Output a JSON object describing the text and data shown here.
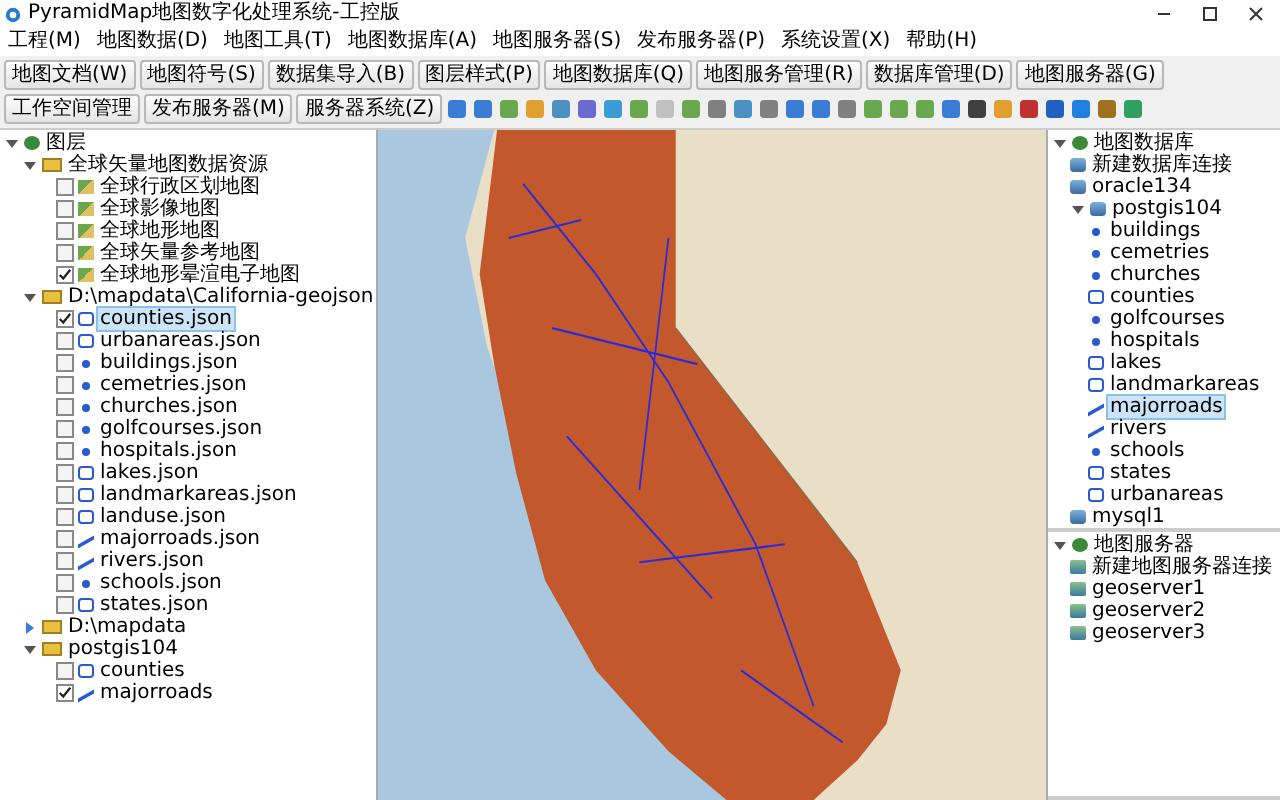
{
  "window": {
    "title": "PyramidMap地图数字化处理系统-工控版"
  },
  "menu": [
    "工程(M)",
    "地图数据(D)",
    "地图工具(T)",
    "地图数据库(A)",
    "地图服务器(S)",
    "发布服务器(P)",
    "系统设置(X)",
    "帮助(H)"
  ],
  "toolbar": [
    "地图文档(W)",
    "地图符号(S)",
    "数据集导入(B)",
    "图层样式(P)",
    "地图数据库(Q)",
    "地图服务管理(R)",
    "数据库管理(D)",
    "地图服务器(G)",
    "工作空间管理",
    "发布服务器(M)",
    "服务器系统(Z)"
  ],
  "layers": {
    "label": "图层",
    "kind": "root",
    "expanded": true,
    "children": [
      {
        "label": "全球矢量地图数据资源",
        "kind": "folder",
        "expanded": true,
        "children": [
          {
            "label": "全球行政区划地图",
            "kind": "raster",
            "checked": false,
            "selected": false
          },
          {
            "label": "全球影像地图",
            "kind": "raster",
            "checked": false,
            "selected": false
          },
          {
            "label": "全球地形地图",
            "kind": "raster",
            "checked": false,
            "selected": false
          },
          {
            "label": "全球矢量参考地图",
            "kind": "raster",
            "checked": false,
            "selected": false
          },
          {
            "label": "全球地形晕渲电子地图",
            "kind": "raster",
            "checked": true,
            "selected": false
          }
        ]
      },
      {
        "label": "D:\\mapdata\\California-geojson",
        "kind": "folder",
        "expanded": true,
        "children": [
          {
            "label": "counties.json",
            "kind": "polygon",
            "checked": true,
            "selected": true
          },
          {
            "label": "urbanareas.json",
            "kind": "polygon",
            "checked": false,
            "selected": false
          },
          {
            "label": "buildings.json",
            "kind": "point",
            "checked": false,
            "selected": false
          },
          {
            "label": "cemetries.json",
            "kind": "point",
            "checked": false,
            "selected": false
          },
          {
            "label": "churches.json",
            "kind": "point",
            "checked": false,
            "selected": false
          },
          {
            "label": "golfcourses.json",
            "kind": "point",
            "checked": false,
            "selected": false
          },
          {
            "label": "hospitals.json",
            "kind": "point",
            "checked": false,
            "selected": false
          },
          {
            "label": "lakes.json",
            "kind": "polygon",
            "checked": false,
            "selected": false
          },
          {
            "label": "landmarkareas.json",
            "kind": "polygon",
            "checked": false,
            "selected": false
          },
          {
            "label": "landuse.json",
            "kind": "polygon",
            "checked": false,
            "selected": false
          },
          {
            "label": "majorroads.json",
            "kind": "line",
            "checked": false,
            "selected": false
          },
          {
            "label": "rivers.json",
            "kind": "line",
            "checked": false,
            "selected": false
          },
          {
            "label": "schools.json",
            "kind": "point",
            "checked": false,
            "selected": false
          },
          {
            "label": "states.json",
            "kind": "polygon",
            "checked": false,
            "selected": false
          }
        ]
      },
      {
        "label": "D:\\mapdata",
        "kind": "folder",
        "expanded": false
      },
      {
        "label": "postgis104",
        "kind": "folder",
        "expanded": true,
        "children": [
          {
            "label": "counties",
            "kind": "polygon",
            "checked": false,
            "selected": false
          },
          {
            "label": "majorroads",
            "kind": "line",
            "checked": true,
            "selected": false
          }
        ]
      }
    ]
  },
  "databases": {
    "label": "地图数据库",
    "kind": "root",
    "expanded": true,
    "children": [
      {
        "label": "新建数据库连接",
        "kind": "db",
        "selected": false
      },
      {
        "label": "oracle134",
        "kind": "db",
        "selected": false
      },
      {
        "label": "postgis104",
        "kind": "db",
        "expanded": true,
        "selected": false,
        "children": [
          {
            "label": "buildings",
            "kind": "point",
            "selected": false
          },
          {
            "label": "cemetries",
            "kind": "point",
            "selected": false
          },
          {
            "label": "churches",
            "kind": "point",
            "selected": false
          },
          {
            "label": "counties",
            "kind": "polygon",
            "selected": false
          },
          {
            "label": "golfcourses",
            "kind": "point",
            "selected": false
          },
          {
            "label": "hospitals",
            "kind": "point",
            "selected": false
          },
          {
            "label": "lakes",
            "kind": "polygon",
            "selected": false
          },
          {
            "label": "landmarkareas",
            "kind": "polygon",
            "selected": false
          },
          {
            "label": "majorroads",
            "kind": "line",
            "selected": true
          },
          {
            "label": "rivers",
            "kind": "line",
            "selected": false
          },
          {
            "label": "schools",
            "kind": "point",
            "selected": false
          },
          {
            "label": "states",
            "kind": "polygon",
            "selected": false
          },
          {
            "label": "urbanareas",
            "kind": "polygon",
            "selected": false
          }
        ]
      },
      {
        "label": "mysql1",
        "kind": "db",
        "selected": false
      }
    ]
  },
  "servers": {
    "label": "地图服务器",
    "kind": "root",
    "expanded": true,
    "children": [
      {
        "label": "新建地图服务器连接",
        "kind": "server",
        "selected": false
      },
      {
        "label": "geoserver1",
        "kind": "server",
        "selected": false
      },
      {
        "label": "geoserver2",
        "kind": "server",
        "selected": false
      },
      {
        "label": "geoserver3",
        "kind": "server",
        "selected": false
      }
    ]
  }
}
